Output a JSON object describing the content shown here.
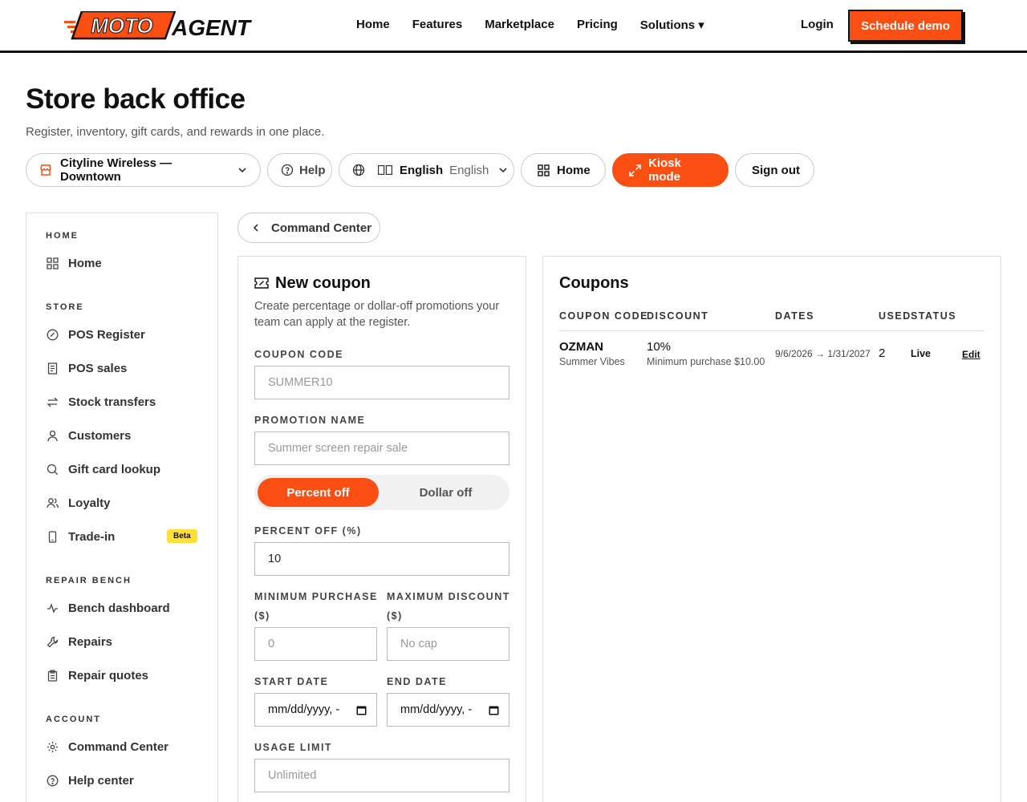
{
  "brand": {
    "logo_moto": "MOTO",
    "logo_agent": "AGENT",
    "accent": "#fa4e12"
  },
  "nav": {
    "links": [
      "Home",
      "Features",
      "Marketplace",
      "Pricing",
      "Solutions ▾"
    ],
    "login": "Login",
    "demo": "Schedule demo"
  },
  "page": {
    "title": "Store back office",
    "subtitle": "Register, inventory, gift cards, and rewards in one place."
  },
  "toolbar": {
    "store": "Cityline Wireless — Downtown",
    "help": "Help",
    "lang_label": "English",
    "lang_value": "English",
    "home": "Home",
    "kiosk": "Kiosk mode",
    "signout": "Sign out"
  },
  "sidebar": {
    "sections": [
      {
        "label": "HOME",
        "items": [
          {
            "label": "Home",
            "icon": "grid-icon"
          }
        ]
      },
      {
        "label": "STORE",
        "items": [
          {
            "label": "POS Register",
            "icon": "register-icon"
          },
          {
            "label": "POS sales",
            "icon": "receipt-icon"
          },
          {
            "label": "Stock transfers",
            "icon": "transfer-icon"
          },
          {
            "label": "Customers",
            "icon": "user-icon"
          },
          {
            "label": "Gift card lookup",
            "icon": "search-icon"
          },
          {
            "label": "Loyalty",
            "icon": "users-icon"
          },
          {
            "label": "Trade-in",
            "icon": "phone-icon",
            "badge": "Beta"
          }
        ]
      },
      {
        "label": "REPAIR BENCH",
        "items": [
          {
            "label": "Bench dashboard",
            "icon": "activity-icon"
          },
          {
            "label": "Repairs",
            "icon": "wrench-icon"
          },
          {
            "label": "Repair quotes",
            "icon": "clipboard-icon"
          }
        ]
      },
      {
        "label": "ACCOUNT",
        "items": [
          {
            "label": "Command Center",
            "icon": "gear-icon"
          },
          {
            "label": "Help center",
            "icon": "help-icon"
          }
        ]
      }
    ]
  },
  "back": {
    "label": "Command Center"
  },
  "form": {
    "title": "New coupon",
    "description": "Create percentage or dollar-off promotions your team can apply at the register.",
    "coupon_code_label": "COUPON CODE",
    "coupon_code_placeholder": "SUMMER10",
    "promotion_name_label": "PROMOTION NAME",
    "promotion_name_placeholder": "Summer screen repair sale",
    "type_options": [
      "Percent off",
      "Dollar off"
    ],
    "percent_label": "PERCENT OFF (%)",
    "percent_value": "10",
    "min_purchase_label_1": "MINIMUM PURCHASE",
    "min_purchase_label_2": "($)",
    "min_purchase_placeholder": "0",
    "max_discount_label_1": "MAXIMUM DISCOUNT",
    "max_discount_label_2": "($)",
    "max_discount_placeholder": "No cap",
    "start_date_label": "START DATE",
    "end_date_label": "END DATE",
    "date_placeholder": "mm/dd/yyyy, -",
    "usage_limit_label": "USAGE LIMIT",
    "usage_limit_placeholder": "Unlimited"
  },
  "coupons": {
    "title": "Coupons",
    "columns": [
      "COUPON CODE",
      "DISCOUNT",
      "DATES",
      "USED",
      "STATUS"
    ],
    "rows": [
      {
        "code": "OZMAN",
        "name": "Summer Vibes",
        "discount": "10%",
        "min_purchase": "Minimum purchase $10.00",
        "dates": "9/6/2026 → 1/31/2027",
        "used": "2",
        "status": "Live",
        "action": "Edit"
      }
    ]
  }
}
